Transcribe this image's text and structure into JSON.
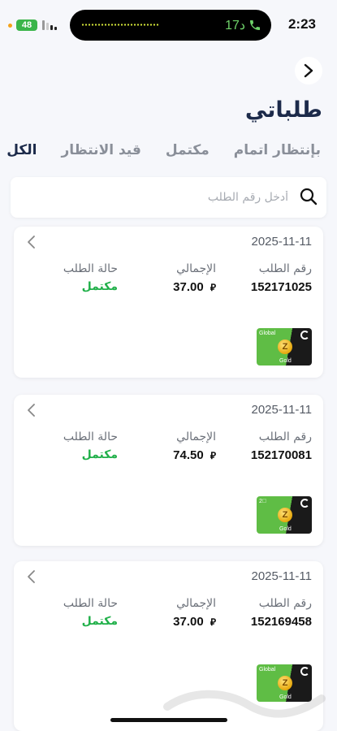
{
  "status_bar": {
    "time": "2:23",
    "battery": "48",
    "call_timer": "17د",
    "battery_color": "#3bb54a",
    "call_color": "#6fd36a"
  },
  "header": {
    "title": "طلباتي",
    "back_icon": "chevron-right-icon"
  },
  "tabs": [
    {
      "label": "الكل",
      "active": true
    },
    {
      "label": "قيد الانتظار",
      "active": false
    },
    {
      "label": "مكتمل",
      "active": false
    },
    {
      "label": "بإنتظار اتمام",
      "active": false
    }
  ],
  "search": {
    "placeholder": "أدخل رقم الطلب",
    "value": "",
    "icon": "search-icon"
  },
  "labels": {
    "order_number": "رقم الطلب",
    "total": "الإجمالي",
    "order_status": "حالة الطلب"
  },
  "orders": [
    {
      "date": "2025-11-11",
      "order_number": "152171025",
      "total": "37.00",
      "status": "مكتمل",
      "card": {
        "top_text": "Global",
        "coin": "Z",
        "bottom_text": "Gold"
      }
    },
    {
      "date": "2025-11-11",
      "order_number": "152170081",
      "total": "74.50",
      "status": "مكتمل",
      "card": {
        "top_text": "2⃣",
        "coin": "Z",
        "bottom_text": "Gold"
      }
    },
    {
      "date": "2025-11-11",
      "order_number": "152169458",
      "total": "37.00",
      "status": "مكتمل",
      "card": {
        "top_text": "Global",
        "coin": "Z",
        "bottom_text": "Gold"
      }
    }
  ],
  "colors": {
    "accent_dark": "#1c2a4a",
    "status_complete": "#21b04a",
    "card_green": "#5fbd45"
  }
}
